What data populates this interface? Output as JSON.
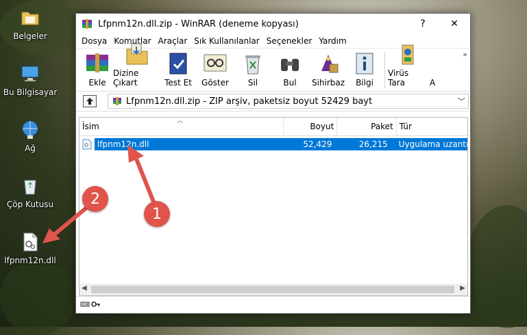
{
  "desktop": {
    "icons": [
      {
        "label": "Belgeler",
        "icon": "folder-icon"
      },
      {
        "label": "Bu Bilgisayar",
        "icon": "computer-icon"
      },
      {
        "label": "Ağ",
        "icon": "network-icon"
      },
      {
        "label": "Çöp Kutusu",
        "icon": "recycle-bin-icon"
      },
      {
        "label": "lfpnm12n.dll",
        "icon": "dll-file-icon"
      }
    ]
  },
  "window": {
    "title": "Lfpnm12n.dll.zip - WinRAR (deneme kopyası)",
    "help_btn": "?",
    "close_btn": "✕",
    "menu": [
      "Dosya",
      "Komutlar",
      "Araçlar",
      "Sık Kullanılanlar",
      "Seçenekler",
      "Yardım"
    ],
    "toolbar": [
      {
        "label": "Ekle",
        "icon": "add-archive-icon"
      },
      {
        "label": "Dizine Çıkart",
        "icon": "extract-to-icon"
      },
      {
        "label": "Test Et",
        "icon": "test-archive-icon"
      },
      {
        "label": "Göster",
        "icon": "view-icon"
      },
      {
        "label": "Sil",
        "icon": "delete-icon"
      },
      {
        "label": "Bul",
        "icon": "find-icon"
      },
      {
        "label": "Sihirbaz",
        "icon": "wizard-icon"
      },
      {
        "label": "Bilgi",
        "icon": "info-icon"
      },
      {
        "label": "Virüs Tara",
        "icon": "virus-scan-icon"
      },
      {
        "label": "A",
        "icon": ""
      }
    ],
    "toolbar_more": "»",
    "path": "Lfpnm12n.dll.zip - ZIP arşiv, paketsiz boyut 52429 bayt",
    "columns": {
      "name": "İsim",
      "size": "Boyut",
      "packed": "Paket",
      "type": "Tür"
    },
    "files": [
      {
        "name": "lfpnm12n.dll",
        "size": "52,429",
        "packed": "26,215",
        "type": "Uygulama uzantısı"
      }
    ]
  },
  "annotations": {
    "marker1": "1",
    "marker2": "2"
  },
  "colors": {
    "selection": "#0078d7",
    "marker": "#e0544c"
  }
}
